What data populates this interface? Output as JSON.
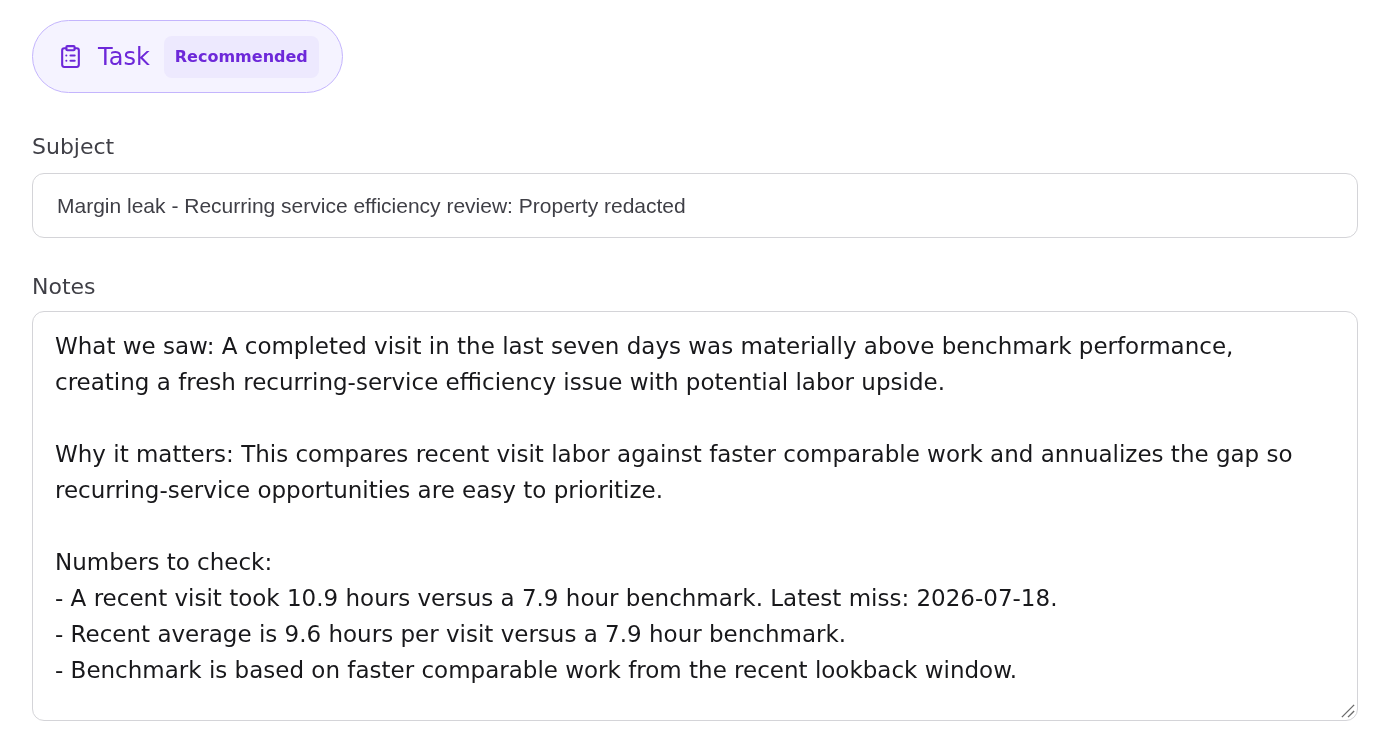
{
  "task_chip": {
    "label": "Task",
    "badge": "Recommended"
  },
  "subject": {
    "label": "Subject",
    "value": "Margin leak - Recurring service efficiency review: Property redacted"
  },
  "notes": {
    "label": "Notes",
    "value": "What we saw: A completed visit in the last seven days was materially above benchmark performance, creating a fresh recurring-service efficiency issue with potential labor upside.\n\nWhy it matters: This compares recent visit labor against faster comparable work and annualizes the gap so recurring-service opportunities are easy to prioritize.\n\nNumbers to check:\n- A recent visit took 10.9 hours versus a 7.9 hour benchmark. Latest miss: 2026-07-18.\n- Recent average is 9.6 hours per visit versus a 7.9 hour benchmark.\n- Benchmark is based on faster comparable work from the recent lookback window."
  }
}
